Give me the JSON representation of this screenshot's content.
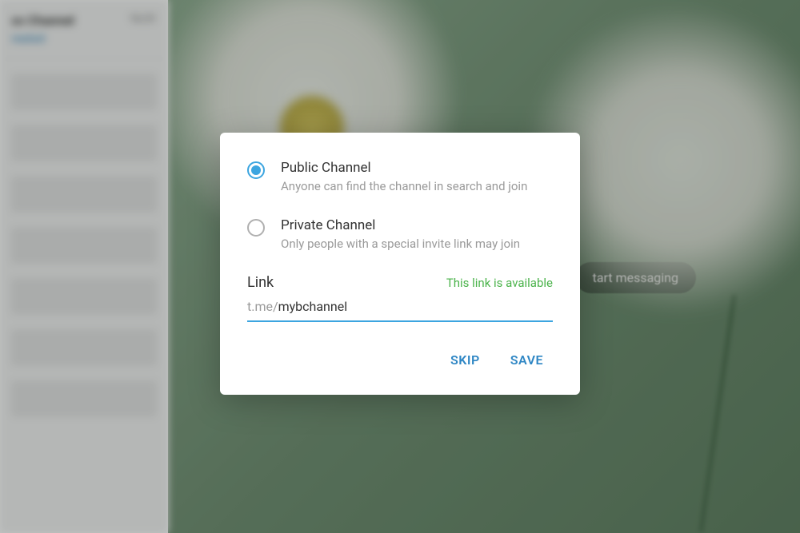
{
  "sidebar": {
    "top_item": {
      "title_fragment": "ss Channel",
      "time": "16:31",
      "subtitle": "reated"
    }
  },
  "chat_hint_fragment": "tart messaging",
  "dialog": {
    "options": [
      {
        "title": "Public Channel",
        "desc": "Anyone can find the channel in search and join",
        "selected": true
      },
      {
        "title": "Private Channel",
        "desc": "Only people with a special invite link may join",
        "selected": false
      }
    ],
    "link": {
      "label": "Link",
      "status": "This link is available",
      "prefix": "t.me/",
      "value": "mybchannel"
    },
    "buttons": {
      "skip": "SKIP",
      "save": "SAVE"
    }
  }
}
